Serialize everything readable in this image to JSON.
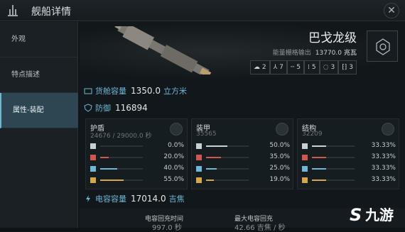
{
  "header": {
    "title": "舰船详情",
    "close_glyph": "✕"
  },
  "sidebar": {
    "items": [
      {
        "label": "外观",
        "active": false
      },
      {
        "label": "特点描述",
        "active": false
      },
      {
        "label": "属性-装配",
        "active": true
      }
    ]
  },
  "ship": {
    "name": "巴戈龙级",
    "power_label": "能量栅格输出",
    "power_value": "13770.0",
    "power_unit": "兆瓦"
  },
  "slots": [
    {
      "icon": "high-slot-icon",
      "value": "2"
    },
    {
      "icon": "mid-slot-icon",
      "value": "7"
    },
    {
      "icon": "low-slot-icon",
      "value": "5"
    },
    {
      "icon": "rig-slot-icon",
      "value": "5"
    },
    {
      "icon": "subsystem-icon",
      "value": "3"
    },
    {
      "icon": "drone-icon",
      "value": "3"
    }
  ],
  "cargo": {
    "label": "货舱容量",
    "value": "1350.0",
    "unit": "立方米"
  },
  "defense": {
    "label": "防御",
    "value": "116894",
    "panels": [
      {
        "title": "护盾",
        "sub": "24676 / 29000.0 秒",
        "icon": "shield-icon",
        "resists": [
          {
            "pct": "0.0%",
            "fill": 0.0,
            "color": "#c9d0d4"
          },
          {
            "pct": "20.0%",
            "fill": 0.2,
            "color": "#d0574e"
          },
          {
            "pct": "40.0%",
            "fill": 0.4,
            "color": "#6fb7d6"
          },
          {
            "pct": "55.0%",
            "fill": 0.55,
            "color": "#d8a64a"
          }
        ]
      },
      {
        "title": "装甲",
        "sub": "35565",
        "icon": "armor-icon",
        "resists": [
          {
            "pct": "50.0%",
            "fill": 0.5,
            "color": "#c9d0d4"
          },
          {
            "pct": "35.0%",
            "fill": 0.35,
            "color": "#d0574e"
          },
          {
            "pct": "25.0%",
            "fill": 0.25,
            "color": "#6fb7d6"
          },
          {
            "pct": "19.0%",
            "fill": 0.19,
            "color": "#d8a64a"
          }
        ]
      },
      {
        "title": "结构",
        "sub": "32209",
        "icon": "structure-icon",
        "resists": [
          {
            "pct": "33.33%",
            "fill": 0.3333,
            "color": "#c9d0d4"
          },
          {
            "pct": "33.33%",
            "fill": 0.3333,
            "color": "#d0574e"
          },
          {
            "pct": "33.33%",
            "fill": 0.3333,
            "color": "#6fb7d6"
          },
          {
            "pct": "33.33%",
            "fill": 0.3333,
            "color": "#d8a64a"
          }
        ]
      }
    ]
  },
  "capacitor": {
    "label": "电容容量",
    "value": "17014.0",
    "unit": "吉焦"
  },
  "bottom": {
    "col1_label": "电容回充时间",
    "col1_value": "997.0 秒",
    "col2_label": "最大电容回充",
    "col2_value": "42.66 吉焦 / 秒"
  },
  "watermark": "九游"
}
